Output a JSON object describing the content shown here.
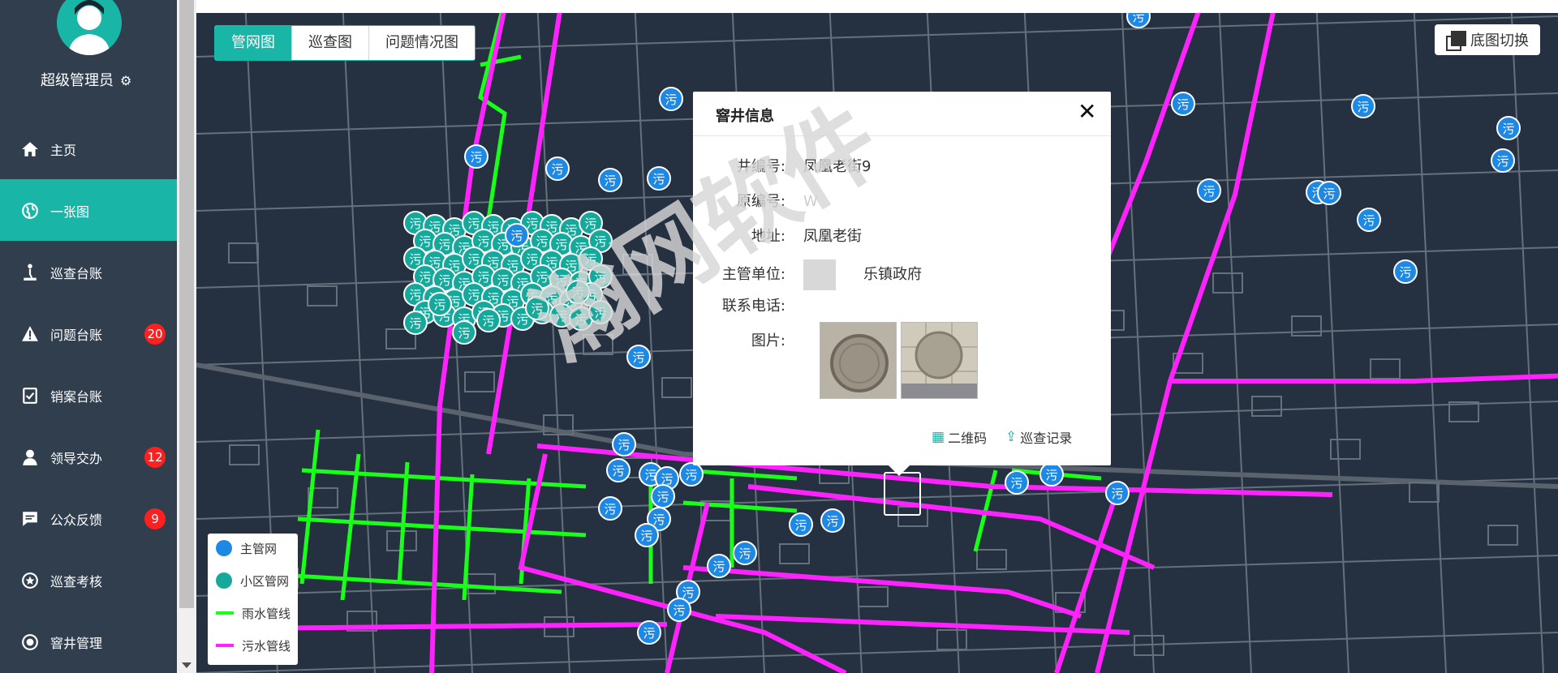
{
  "sidebar": {
    "user": "超级管理员",
    "items": [
      {
        "label": "主页",
        "icon": "home-icon",
        "badge": ""
      },
      {
        "label": "一张图",
        "icon": "globe-icon",
        "badge": ""
      },
      {
        "label": "巡查台账",
        "icon": "person-walk-icon",
        "badge": ""
      },
      {
        "label": "问题台账",
        "icon": "warning-icon",
        "badge": "20"
      },
      {
        "label": "销案台账",
        "icon": "check-list-icon",
        "badge": ""
      },
      {
        "label": "领导交办",
        "icon": "user-icon",
        "badge": "12"
      },
      {
        "label": "公众反馈",
        "icon": "chat-icon",
        "badge": "9"
      },
      {
        "label": "巡查考核",
        "icon": "star-badge-icon",
        "badge": ""
      },
      {
        "label": "窨井管理",
        "icon": "target-icon",
        "badge": ""
      }
    ]
  },
  "tabs": [
    "管网图",
    "巡查图",
    "问题情况图"
  ],
  "basemap_button": "底图切换",
  "legend": [
    {
      "label": "主管网",
      "color": "#1e88e5"
    },
    {
      "label": "小区管网",
      "color": "#16a99b"
    },
    {
      "label": "雨水管线",
      "color": "#1aff1a"
    },
    {
      "label": "污水管线",
      "color": "#ff22ff"
    }
  ],
  "marker_label": "污",
  "watermark": "瀚网软件",
  "popup": {
    "title": "窨井信息",
    "fields": [
      {
        "key": "井编号:",
        "value": "凤凰老街9"
      },
      {
        "key": "原编号:",
        "value": "W"
      },
      {
        "key": "地址:",
        "value": "凤凰老街"
      },
      {
        "key": "主管单位:",
        "value": "乐镇政府"
      },
      {
        "key": "联系电话:",
        "value": ""
      },
      {
        "key": "图片:",
        "value": ""
      }
    ],
    "actions": {
      "qrcode": "二维码",
      "record": "巡查记录"
    }
  }
}
